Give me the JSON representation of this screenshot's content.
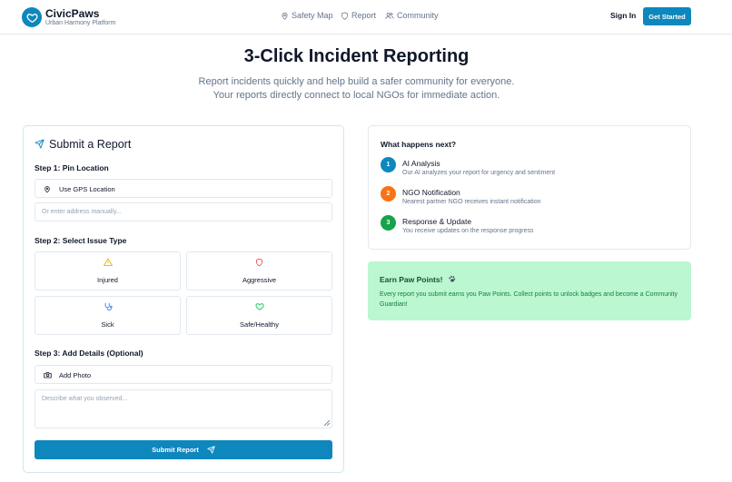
{
  "header": {
    "brand": "CivicPaws",
    "tagline": "Urban Harmony Platform",
    "nav": [
      {
        "label": "Safety Map",
        "icon": "map-pin-icon"
      },
      {
        "label": "Report",
        "icon": "shield-icon"
      },
      {
        "label": "Community",
        "icon": "users-icon"
      }
    ],
    "sign_in": "Sign In",
    "cta": "Get Started"
  },
  "hero": {
    "title": "3-Click Incident Reporting",
    "line1": "Report incidents quickly and help build a safer community for everyone.",
    "line2": "Your reports directly connect to local NGOs for immediate action."
  },
  "report": {
    "title": "Submit a Report",
    "step1": "Step 1: Pin Location",
    "gps_label": "Use GPS Location",
    "address_placeholder": "Or enter address manually...",
    "step2": "Step 2: Select Issue Type",
    "issues": [
      {
        "label": "Injured",
        "icon": "warning-icon",
        "color": "#eab308"
      },
      {
        "label": "Aggressive",
        "icon": "shield-icon",
        "color": "#ef4444"
      },
      {
        "label": "Sick",
        "icon": "stethoscope-icon",
        "color": "#3b82f6"
      },
      {
        "label": "Safe/Healthy",
        "icon": "heart-icon",
        "color": "#22c55e"
      }
    ],
    "step3": "Step 3: Add Details (Optional)",
    "photo_label": "Add Photo",
    "details_placeholder": "Describe what you observed...",
    "submit": "Submit Report"
  },
  "next": {
    "title": "What happens next?",
    "items": [
      {
        "num": "1",
        "title": "AI Analysis",
        "desc": "Our AI analyzes your report for urgency and sentiment",
        "color": "#0e87bd"
      },
      {
        "num": "2",
        "title": "NGO Notification",
        "desc": "Nearest partner NGO receives instant notification",
        "color": "#f97316"
      },
      {
        "num": "3",
        "title": "Response & Update",
        "desc": "You receive updates on the response progress",
        "color": "#16a34a"
      }
    ]
  },
  "paw": {
    "title": "Earn Paw Points!",
    "icon": "paw-icon",
    "desc": "Every report you submit earns you Paw Points. Collect points to unlock badges and become a Community Guardian!"
  },
  "colors": {
    "primary": "#0e87bd",
    "paw_bg": "#bbf7d0"
  }
}
